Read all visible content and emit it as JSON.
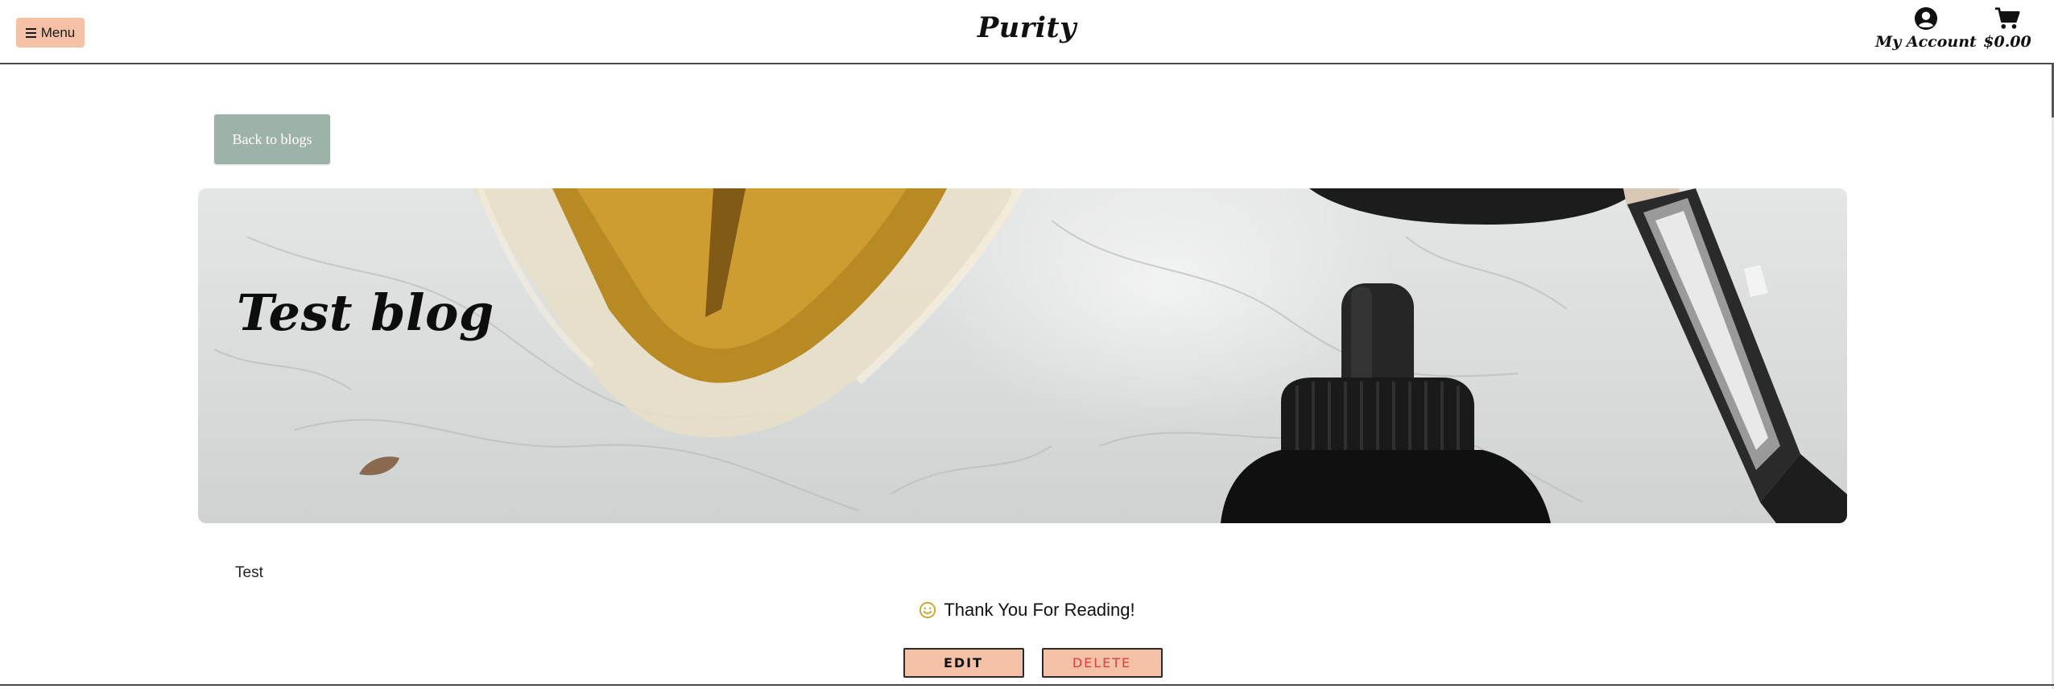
{
  "header": {
    "menu_label": "Menu",
    "brand": "Purity",
    "account_label": "My Account",
    "cart_total": "$0.00"
  },
  "icons": {
    "menu": "hamburger-icon",
    "account": "user-circle-icon",
    "cart": "shopping-cart-icon",
    "thanks": "smile-icon"
  },
  "nav": {
    "back_label": "Back to blogs"
  },
  "post": {
    "title": "Test blog",
    "body": "Test",
    "thanks_text": "Thank You For Reading!"
  },
  "actions": {
    "edit_label": "EDIT",
    "delete_label": "DELETE"
  },
  "colors": {
    "accent_peach": "#f4c1a6",
    "back_button_sage": "#9db3a8",
    "delete_text": "#e0403c",
    "smile_icon": "#c9a227"
  }
}
